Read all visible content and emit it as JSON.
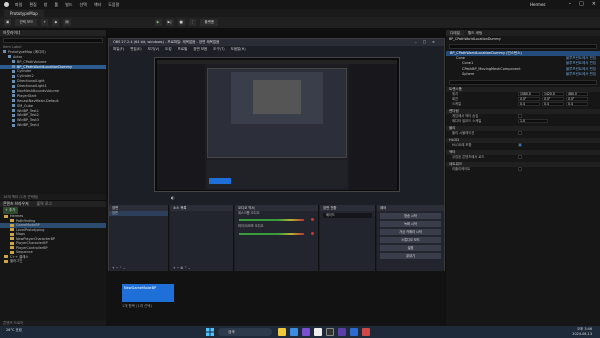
{
  "app": {
    "title": "Hermes",
    "tab": "PrototypeMap"
  },
  "menu": [
    "파일",
    "편집",
    "창",
    "툴",
    "빌드",
    "선택",
    "액터",
    "도움말"
  ],
  "toolbar": {
    "mode": "선택 모드",
    "platform": "플랫폼"
  },
  "outliner": {
    "title": "아웃라이너",
    "header": "Item Label",
    "items": [
      "PrototypeMap (에디터)",
      "Actor",
      "BP_CPathVolume",
      "BP_CPathWorldLocationDummy",
      "Cylinder",
      "Cylinder2",
      "DirectionalLight",
      "DirectionalLight1",
      "NavMeshBoundsVolume",
      "PlayerStart",
      "RecastNavMesh-Default",
      "SM_Cube",
      "WidBP_Test1",
      "WidBP_Test2",
      "WidBP_Test3",
      "WidBP_Test4"
    ],
    "selected_index": 3,
    "status": "16개 액터 (1개 선택됨)"
  },
  "content": {
    "title": "콘텐츠 브라우저",
    "tab2": "출력 로그",
    "add": "+ 추가",
    "items": [
      "Hermes",
      "Pathfinding",
      "GameModeBP",
      "LevelPrototyping",
      "Maps",
      "NewPlayerCharacterBP",
      "PlayerCharacterBP",
      "PlayerControllerBP",
      "Sequence",
      "C++ 클래스",
      "플러그인"
    ],
    "selected_index": 2,
    "asset_name": "NewGameModeBP",
    "asset_count": "1개 항목 (1개 선택)",
    "status": "콘텐츠 드로어"
  },
  "obs": {
    "title": "OBS 27.2.4 (64 bit, windows) - 프로파일: 제목없음 - 장면 제목없음",
    "menu": [
      "파일(F)",
      "편집(E)",
      "보기(V)",
      "도킹",
      "프로필",
      "장면 모음",
      "도구(T)",
      "도움말(H)"
    ],
    "docks": [
      "장면",
      "소스 목록",
      "오디오 믹서",
      "장면 전환",
      "제어"
    ],
    "scene_item": "장면",
    "audio": [
      "데스크톱 오디오",
      "마이크/보조 오디오"
    ],
    "transition": "페이드",
    "controls": [
      "방송 시작",
      "녹화 시작",
      "가상 카메라 시작",
      "스튜디오 모드",
      "설정",
      "끝내기"
    ]
  },
  "details": {
    "tab1": "디테일",
    "tab2": "월드 세팅",
    "object": "BP_CPathWorldLocationDummy",
    "components": [
      {
        "name": "BP_CPathWorldLocationDummy (인스턴스)",
        "link": ""
      },
      {
        "name": "Cone",
        "link": "블루프린트에서 편집"
      },
      {
        "name": "Cone1",
        "link": "블루프린트에서 편집"
      },
      {
        "name": "CPathBP_MovingMeshComponent",
        "link": "블루프린트에서 편집"
      },
      {
        "name": "Sphere",
        "link": "블루프린트에서 편집"
      }
    ],
    "sections": [
      {
        "name": "트랜스폼",
        "rows": [
          [
            "위치",
            "1580.0",
            "1420.0",
            "480.0"
          ],
          [
            "회전",
            "0.0°",
            "0.0°",
            "0.0°"
          ],
          [
            "스케일",
            "0.4",
            "0.4",
            "0.4"
          ]
        ]
      },
      {
        "name": "렌더링",
        "rows": [
          [
            "게임에서 액터 숨김",
            ""
          ],
          [
            "에디터 빌보드 스케일",
            "1.0"
          ]
        ]
      },
      {
        "name": "물리",
        "rows": [
          [
            "물리 시뮬레이션",
            ""
          ]
        ]
      },
      {
        "name": "HLOD",
        "rows": [
          [
            "HLOD에 포함",
            ""
          ]
        ]
      },
      {
        "name": "액터",
        "rows": [
          [
            "쿠킹된 콘텐츠에서 로드",
            ""
          ]
        ]
      },
      {
        "name": "네트워크",
        "rows": [
          [
            "리플리케이트",
            ""
          ]
        ]
      }
    ]
  },
  "taskbar": {
    "search": "검색",
    "time": "오후 3:46",
    "date": "2024-06-13",
    "weather": "26°C 흐림"
  }
}
